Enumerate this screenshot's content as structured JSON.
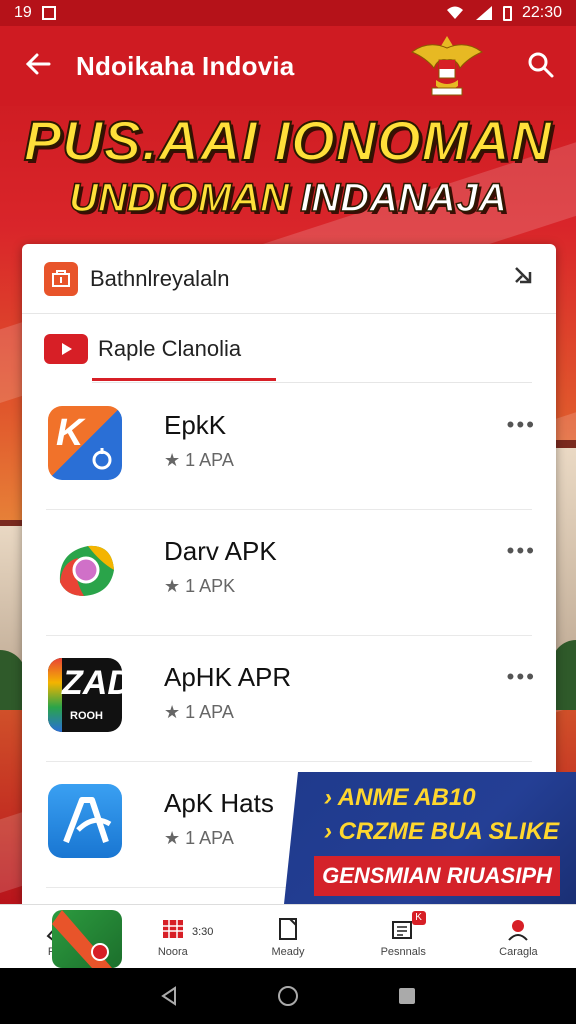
{
  "status_bar": {
    "left_text": "19",
    "time": "22:30"
  },
  "app_bar": {
    "title": "Ndoikaha Indovia"
  },
  "banner": {
    "line1": "PUS.AAI IONOMAN",
    "line2_yellow": "UNDIOMAN",
    "line2_white": "INDANAJA"
  },
  "card": {
    "header_label": "Bathnlreyalaln",
    "tab_label": "Raple Clanolia",
    "apps": [
      {
        "name": "EpkK",
        "meta": "1 APA"
      },
      {
        "name": "Darv APK",
        "meta": "1 APK"
      },
      {
        "name": "ApHK APR",
        "meta": "1 APA"
      },
      {
        "name": "ApK Hats",
        "meta": "1 APA"
      }
    ],
    "app_icon_text": {
      "icon1": "K",
      "icon3_big": "ZAD",
      "icon3_small": "ROOH"
    }
  },
  "promo": {
    "line1": "ANME AB10",
    "line2": "CRZME BUA SLIKE",
    "ribbon": "GENSMIAN RIUASIPH"
  },
  "bottom_nav": {
    "items": [
      {
        "label": "Pau"
      },
      {
        "label": "Noora"
      },
      {
        "label": "Meady"
      },
      {
        "label": "Pesnnals",
        "badge": "K"
      },
      {
        "label": "Caragla"
      }
    ],
    "extra_text": "3:30"
  },
  "colors": {
    "brand_red": "#cf1b22",
    "banner_yellow": "#ffe03a",
    "promo_blue": "#243f95"
  }
}
